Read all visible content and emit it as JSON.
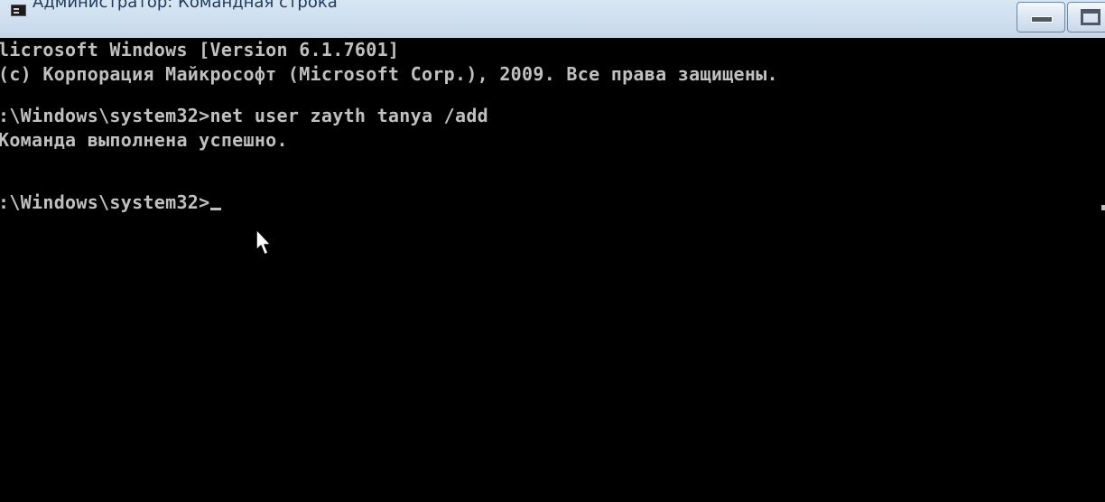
{
  "window": {
    "title": "Администратор: Командная строка",
    "title_icon": "cmd-icon",
    "buttons": {
      "minimize": "minimize-icon",
      "maximize": "maximize-icon"
    }
  },
  "console": {
    "background": "#000000",
    "foreground": "#c0c0c0",
    "lines": [
      "licrosoft Windows [Version 6.1.7601]",
      "(c) Корпорация Майкрософт (Microsoft Corp.), 2009. Все права защищены.",
      ":\\Windows\\system32>net user zayth tanya /add",
      "Команда выполнена успешно.",
      ":\\Windows\\system32>"
    ]
  },
  "pointer": "arrow-cursor-icon"
}
